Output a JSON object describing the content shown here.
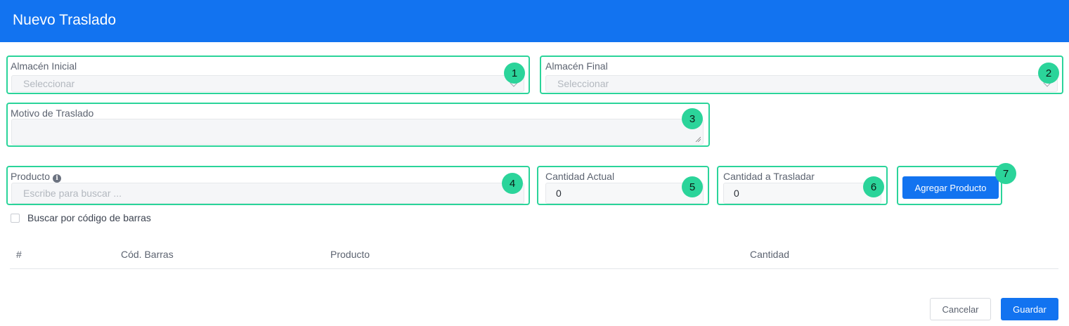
{
  "header": {
    "title": "Nuevo Traslado"
  },
  "colors": {
    "primary": "#1273f0",
    "highlight": "#2bd49a"
  },
  "almacen_inicial": {
    "label": "Almacén Inicial",
    "placeholder": "Seleccionar",
    "badge": "1"
  },
  "almacen_final": {
    "label": "Almacén Final",
    "placeholder": "Seleccionar",
    "badge": "2"
  },
  "motivo": {
    "label": "Motivo de Traslado",
    "value": "",
    "badge": "3"
  },
  "producto": {
    "label": "Producto",
    "placeholder": "Escribe para buscar ...",
    "badge": "4",
    "info_icon": "info-icon"
  },
  "cantidad_actual": {
    "label": "Cantidad Actual",
    "value": "0",
    "badge": "5"
  },
  "cantidad_trasladar": {
    "label": "Cantidad a Trasladar",
    "value": "0",
    "badge": "6"
  },
  "agregar": {
    "label": "Agregar Producto",
    "badge": "7"
  },
  "barcode_search": {
    "label": "Buscar por código de barras",
    "checked": false
  },
  "table": {
    "columns": [
      "#",
      "Cód. Barras",
      "Producto",
      "Cantidad"
    ],
    "rows": []
  },
  "footer": {
    "cancel_label": "Cancelar",
    "save_label": "Guardar"
  }
}
